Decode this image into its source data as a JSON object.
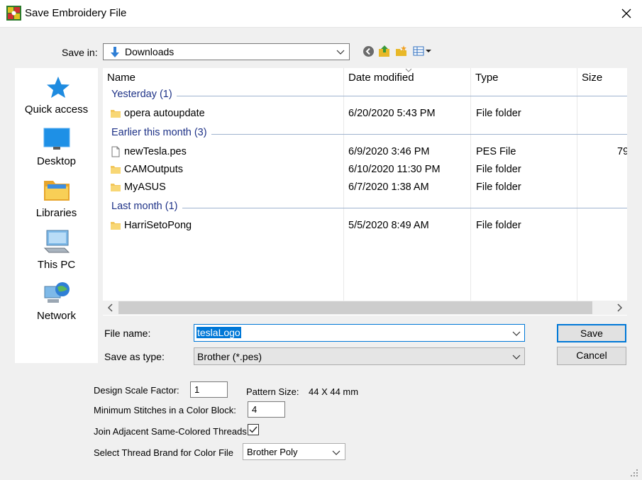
{
  "window": {
    "title": "Save Embroidery File",
    "icon": "embroidery-app-icon"
  },
  "save_in": {
    "label": "Save in:",
    "value": "Downloads"
  },
  "toolbar": {
    "back": "back-icon",
    "up": "up-folder-icon",
    "new_folder": "new-folder-icon",
    "view": "view-menu-icon"
  },
  "places": [
    {
      "label": "Quick access",
      "icon": "star-icon"
    },
    {
      "label": "Desktop",
      "icon": "desktop-icon"
    },
    {
      "label": "Libraries",
      "icon": "libraries-icon"
    },
    {
      "label": "This PC",
      "icon": "computer-icon"
    },
    {
      "label": "Network",
      "icon": "network-icon"
    }
  ],
  "columns": {
    "name": "Name",
    "date": "Date modified",
    "type": "Type",
    "size": "Size"
  },
  "groups": [
    {
      "label": "Yesterday (1)"
    },
    {
      "label": "Earlier this month (3)"
    },
    {
      "label": "Last month (1)"
    }
  ],
  "files": [
    {
      "name": "opera autoupdate",
      "date": "6/20/2020 5:43 PM",
      "type": "File folder",
      "size": "",
      "icon": "folder-icon"
    },
    {
      "name": "newTesla.pes",
      "date": "6/9/2020 3:46 PM",
      "type": "PES File",
      "size": "79",
      "icon": "file-icon"
    },
    {
      "name": "CAMOutputs",
      "date": "6/10/2020 11:30 PM",
      "type": "File folder",
      "size": "",
      "icon": "folder-icon"
    },
    {
      "name": "MyASUS",
      "date": "6/7/2020 1:38 AM",
      "type": "File folder",
      "size": "",
      "icon": "folder-icon"
    },
    {
      "name": "HarriSetoPong",
      "date": "5/5/2020 8:49 AM",
      "type": "File folder",
      "size": "",
      "icon": "folder-icon"
    }
  ],
  "file_name": {
    "label": "File name:",
    "value": "teslaLogo"
  },
  "save_as_type": {
    "label": "Save as type:",
    "value": "Brother (*.pes)"
  },
  "buttons": {
    "save": "Save",
    "cancel": "Cancel"
  },
  "options": {
    "scale_label": "Design Scale Factor:",
    "scale_value": "1",
    "pattern_size_label": "Pattern Size:",
    "pattern_size_value": "44 X 44 mm",
    "min_stitches_label": "Minimum Stitches in a Color Block:",
    "min_stitches_value": "4",
    "join_label": "Join Adjacent Same-Colored Threads",
    "join_checked": true,
    "brand_label": "Select Thread Brand for Color File",
    "brand_value": "Brother Poly"
  }
}
